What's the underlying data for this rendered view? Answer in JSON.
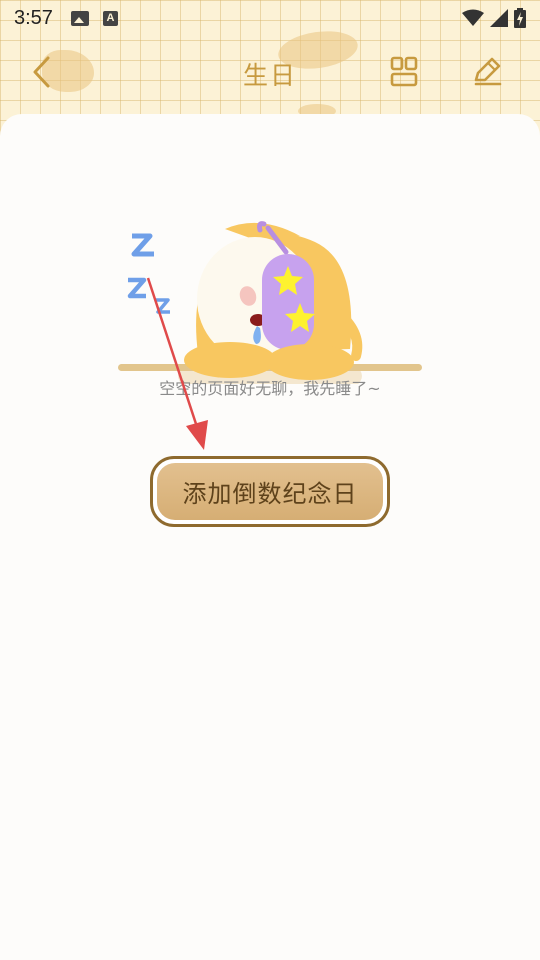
{
  "status_bar": {
    "time": "3:57",
    "left_icons": [
      "image-icon",
      "a-icon"
    ],
    "right_icons": [
      "wifi-icon",
      "signal-icon",
      "battery-icon"
    ]
  },
  "header": {
    "title": "生日",
    "back_icon": "chevron-left-icon",
    "grid_icon": "grid-icon",
    "edit_icon": "pencil-icon"
  },
  "empty_state": {
    "message": "空空的页面好无聊，我先睡了~"
  },
  "add_button": {
    "label": "添加倒数纪念日"
  },
  "colors": {
    "accent": "#c79a3f",
    "button_fill": "#dcb883",
    "button_border": "#8e6a2e",
    "annotation_arrow": "#e04a4a"
  }
}
